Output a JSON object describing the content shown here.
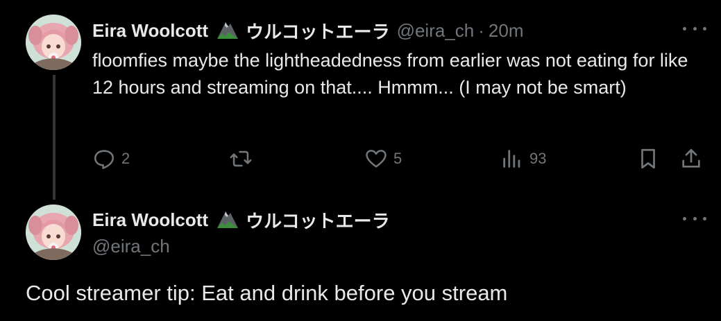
{
  "colors": {
    "background": "#000000",
    "text_primary": "#e7e9ea",
    "text_secondary": "#71767b",
    "thread_line": "#333639"
  },
  "reply_tweet": {
    "display_name": "Eira Woolcott",
    "name_emoji": "mountain-icon",
    "name_jp": "ウルコットエーラ",
    "handle": "@eira_ch",
    "separator": "·",
    "time": "20m",
    "text": "floomfies maybe the lightheadedness from earlier was not eating for like 12 hours and streaming on that.... Hmmm... (I may not be smart)",
    "actions": {
      "replies": "2",
      "reposts": "",
      "likes": "5",
      "views": "93"
    }
  },
  "main_tweet": {
    "display_name": "Eira Woolcott",
    "name_emoji": "mountain-icon",
    "name_jp": "ウルコットエーラ",
    "handle": "@eira_ch",
    "text": "Cool streamer tip: Eat and drink before you stream"
  }
}
